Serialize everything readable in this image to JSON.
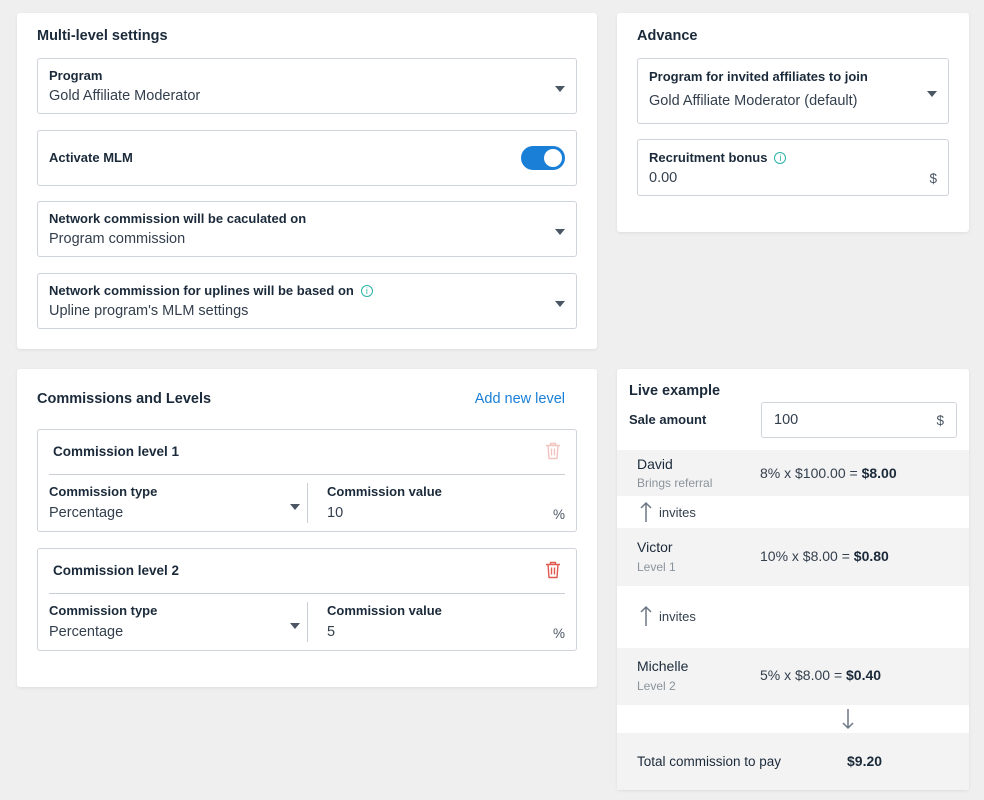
{
  "multilevel": {
    "title": "Multi-level settings",
    "program_label": "Program",
    "program_value": "Gold Affiliate Moderator",
    "activate_label": "Activate MLM",
    "activate_on": true,
    "network_calc_label": "Network commission will be caculated on",
    "network_calc_value": "Program commission",
    "uplines_label": "Network commission for uplines will be based on",
    "uplines_value": "Upline program's MLM settings"
  },
  "advance": {
    "title": "Advance",
    "invited_label": "Program for invited affiliates to join",
    "invited_value": "Gold Affiliate Moderator (default)",
    "bonus_label": "Recruitment bonus",
    "bonus_value": "0.00",
    "bonus_unit": "$"
  },
  "levels": {
    "title": "Commissions and Levels",
    "add_label": "Add new level",
    "items": [
      {
        "title": "Commission level 1",
        "type_label": "Commission type",
        "type_value": "Percentage",
        "value_label": "Commission value",
        "value": "10",
        "unit": "%",
        "delete_enabled": false
      },
      {
        "title": "Commission level 2",
        "type_label": "Commission type",
        "type_value": "Percentage",
        "value_label": "Commission value",
        "value": "5",
        "unit": "%",
        "delete_enabled": true
      }
    ]
  },
  "live": {
    "title": "Live example",
    "sale_label": "Sale amount",
    "sale_value": "100",
    "sale_unit": "$",
    "rows": [
      {
        "name": "David",
        "sub": "Brings referral",
        "formula": "8% x $100.00 = ",
        "result": "$8.00"
      },
      {
        "name": "Victor",
        "sub": "Level 1",
        "formula": "10% x $8.00 = ",
        "result": "$0.80"
      },
      {
        "name": "Michelle",
        "sub": "Level 2",
        "formula": "5% x $8.00 = ",
        "result": "$0.40"
      }
    ],
    "invites_label": "invites",
    "total_label": "Total commission to pay",
    "total_value": "$9.20"
  },
  "colors": {
    "accent": "#1a7fd6",
    "info": "#2bb3a8",
    "delete": "#e0584d",
    "delete_disabled": "#f2c4c0"
  }
}
